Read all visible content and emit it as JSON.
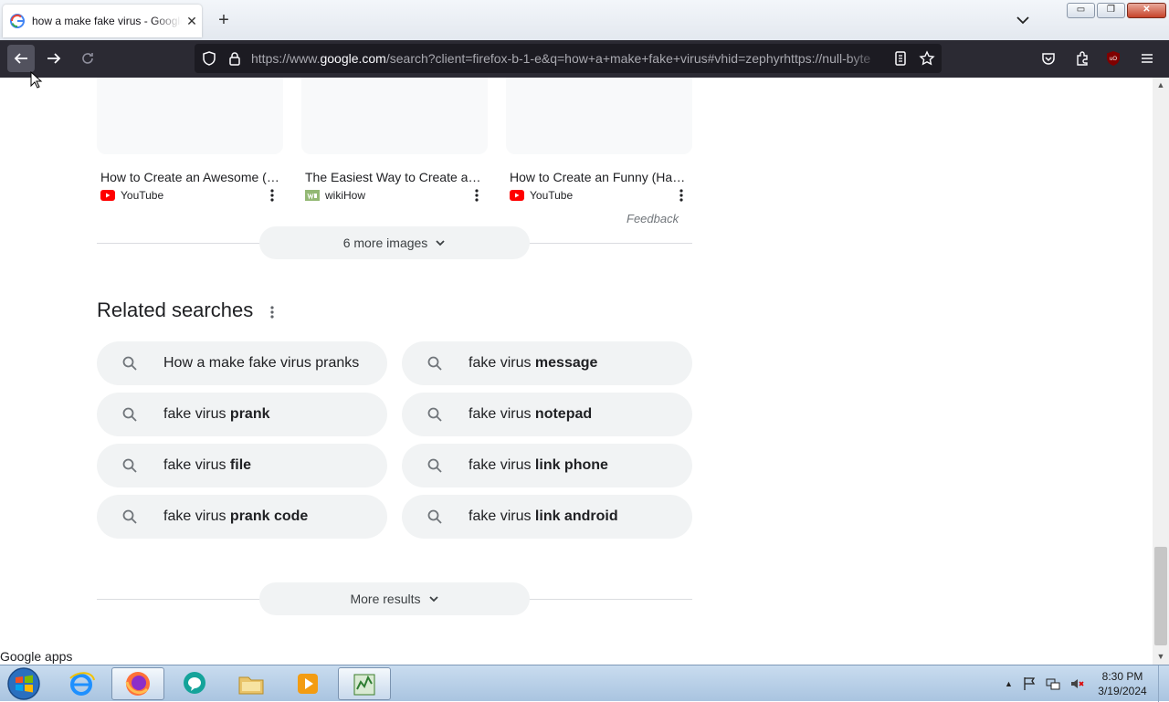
{
  "browser": {
    "tab_title": "how a make fake virus - Google",
    "tab_close": "✕",
    "new_tab": "+",
    "url_prefix": "https://www.",
    "url_host": "google.com",
    "url_rest": "/search?client=firefox-b-1-e&q=how+a+make+fake+virus#vhid=zephyrhttps://null-byte",
    "win_min": "▭",
    "win_restore": "❐",
    "win_close": "✕"
  },
  "images": {
    "items": [
      {
        "title": "How to Create an Awesome (Harmless) Fake Virus",
        "source": "YouTube",
        "source_icon": "youtube-icon"
      },
      {
        "title": "The Easiest Way to Create a Fake Virus",
        "source": "wikiHow",
        "source_icon": "wikihow-icon"
      },
      {
        "title": "How to Create an Funny (Harmless) Virus",
        "source": "YouTube",
        "source_icon": "youtube-icon"
      }
    ],
    "feedback": "Feedback",
    "more_images": "6 more images"
  },
  "related": {
    "title": "Related searches",
    "chips": [
      {
        "plain": "How a make fake virus pranks",
        "bold": ""
      },
      {
        "plain": "fake virus ",
        "bold": "message"
      },
      {
        "plain": "fake virus ",
        "bold": "prank"
      },
      {
        "plain": "fake virus ",
        "bold": "notepad"
      },
      {
        "plain": "fake virus ",
        "bold": "file"
      },
      {
        "plain": "fake virus ",
        "bold": "link phone"
      },
      {
        "plain": "fake virus ",
        "bold": "prank code"
      },
      {
        "plain": "fake virus ",
        "bold": "link android"
      }
    ]
  },
  "more_results": "More results",
  "google_apps": "Google apps",
  "taskbar": {
    "time": "8:30 PM",
    "date": "3/19/2024"
  },
  "colors": {
    "accent_youtube": "#ff0000",
    "toolbar_bg": "#2b2a33",
    "chip_bg": "#f1f3f4"
  }
}
